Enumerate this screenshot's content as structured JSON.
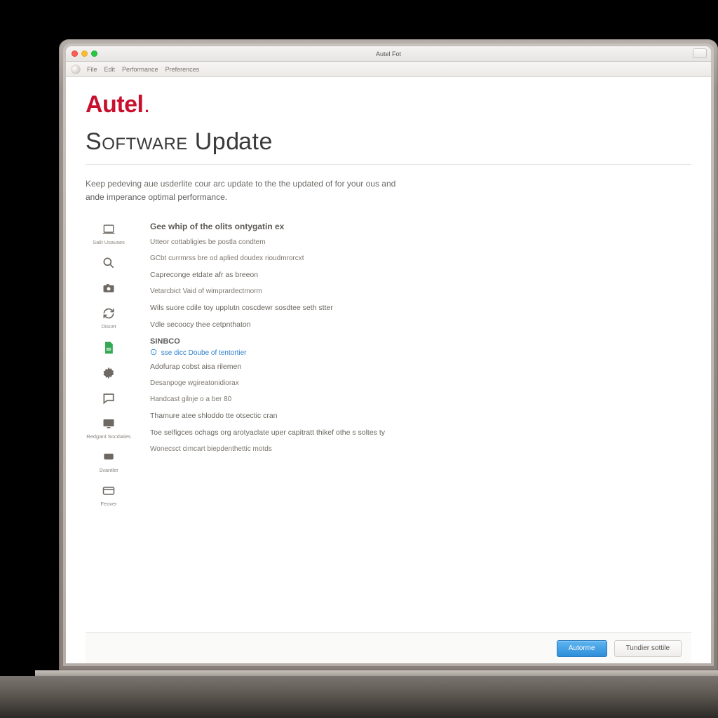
{
  "window": {
    "title": "Autel Fot"
  },
  "toolbar": {
    "items": [
      "File",
      "Edit",
      "Performance",
      "Preferences"
    ]
  },
  "brand": "Autel",
  "page_title": "Software Update",
  "intro_line1": "Keep pedeving aue usderlite cour arc update to the the updated of for your ous and",
  "intro_line2": "ande imperance optimal performance.",
  "content": {
    "heading": "Gee whip of the olits ontygatin ex",
    "lines": [
      "Utteor cottabligies be postla condtem",
      "GCbt currmrss bre od aplied doudex rioudmrorcxt",
      "Capreconge etdate afr as breeon",
      "Vetarcbict Vaid of wimprardectmorm",
      "Wils suore cdile toy upplutn coscdewr sosdtee seth stter",
      "Vdle secoocy thee cetpnthaton"
    ],
    "subheading": "SINBCO",
    "link_text": "sse dicc Doube of tentortier",
    "more_lines": [
      "Adofurap cobst aisa rilemen",
      "Desanpoge wgireatonidiorax",
      "Handcast gilnje o a ber 80",
      "Thamure atee shloddo tte otsectic cran",
      "Toe selfigces ochags org arotyaclate uper capitratt thikef othe s soltes ty",
      "Wonecsct cimcart biepdenthettic motds"
    ]
  },
  "sidebar": {
    "items": [
      {
        "label": "Salit Usauses",
        "icon": "device"
      },
      {
        "label": "",
        "icon": "search"
      },
      {
        "label": "",
        "icon": "camera"
      },
      {
        "label": "Discet",
        "icon": "refresh"
      },
      {
        "label": "",
        "icon": "doc-green"
      },
      {
        "label": "",
        "icon": "gear"
      },
      {
        "label": "",
        "icon": "chat"
      },
      {
        "label": "Redgant Socdaties",
        "icon": "monitor"
      },
      {
        "label": "Svantler",
        "icon": "chat-small"
      },
      {
        "label": "Feover",
        "icon": "card"
      }
    ]
  },
  "footer": {
    "primary": "Autorme",
    "secondary": "Tundier sottile"
  },
  "colors": {
    "brand": "#c8102e",
    "primary_btn": "#3a97e0",
    "link": "#2a7ec7"
  }
}
